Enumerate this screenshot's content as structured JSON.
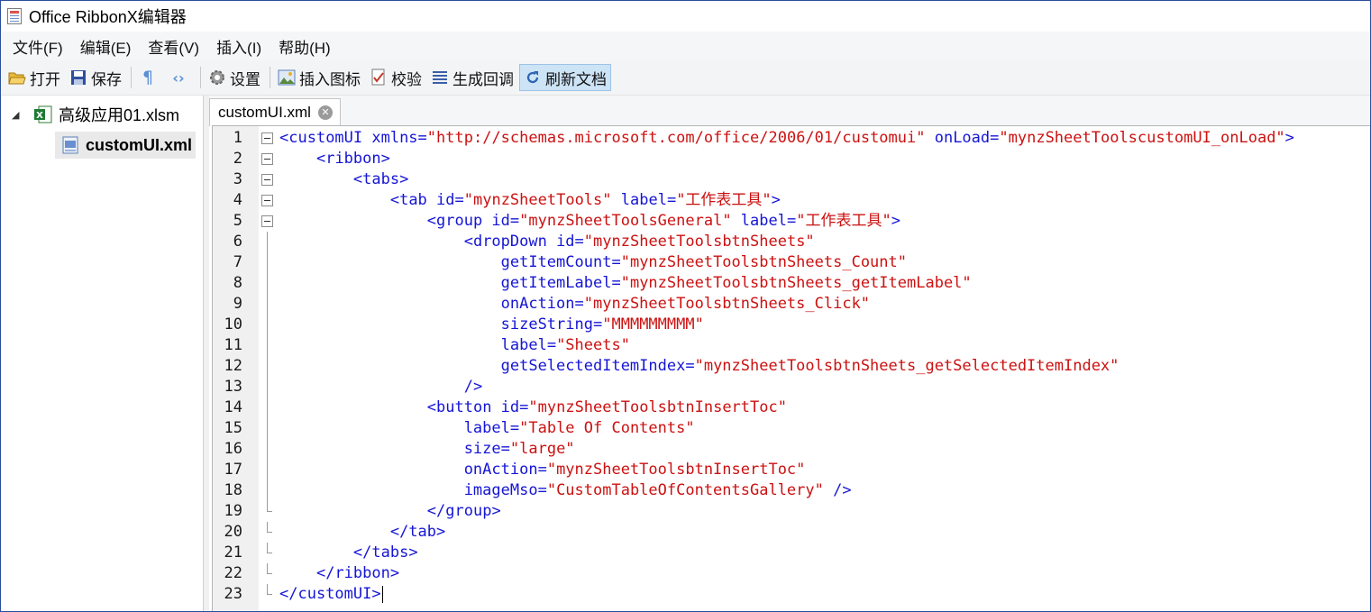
{
  "window": {
    "title": "Office RibbonX编辑器"
  },
  "menu": [
    "文件(F)",
    "编辑(E)",
    "查看(V)",
    "插入(I)",
    "帮助(H)"
  ],
  "toolbar": {
    "open": "打开",
    "save": "保存",
    "settings": "设置",
    "insert_icon": "插入图标",
    "validate": "校验",
    "generate_callbacks": "生成回调",
    "refresh_document": "刷新文档"
  },
  "tree": {
    "root": "高级应用01.xlsm",
    "child": "customUI.xml"
  },
  "editor": {
    "tab_label": "customUI.xml",
    "lines": [
      "<customUI xmlns=\"http://schemas.microsoft.com/office/2006/01/customui\" onLoad=\"mynzSheetToolscustomUI_onLoad\">",
      "    <ribbon>",
      "        <tabs>",
      "            <tab id=\"mynzSheetTools\" label=\"工作表工具\">",
      "                <group id=\"mynzSheetToolsGeneral\" label=\"工作表工具\">",
      "                    <dropDown id=\"mynzSheetToolsbtnSheets\"",
      "                        getItemCount=\"mynzSheetToolsbtnSheets_Count\"",
      "                        getItemLabel=\"mynzSheetToolsbtnSheets_getItemLabel\"",
      "                        onAction=\"mynzSheetToolsbtnSheets_Click\"",
      "                        sizeString=\"MMMMMMMMM\"",
      "                        label=\"Sheets\"",
      "                        getSelectedItemIndex=\"mynzSheetToolsbtnSheets_getSelectedItemIndex\"",
      "                    />",
      "                <button id=\"mynzSheetToolsbtnInsertToc\"",
      "                    label=\"Table Of Contents\"",
      "                    size=\"large\"",
      "                    onAction=\"mynzSheetToolsbtnInsertToc\"",
      "                    imageMso=\"CustomTableOfContentsGallery\" />",
      "                </group>",
      "            </tab>",
      "        </tabs>",
      "    </ribbon>",
      "</customUI>"
    ]
  },
  "colors": {
    "tag": "#1515d6",
    "value": "#cc1111",
    "active_button": "#cde3f6",
    "window_border": "#2b4f9c"
  }
}
